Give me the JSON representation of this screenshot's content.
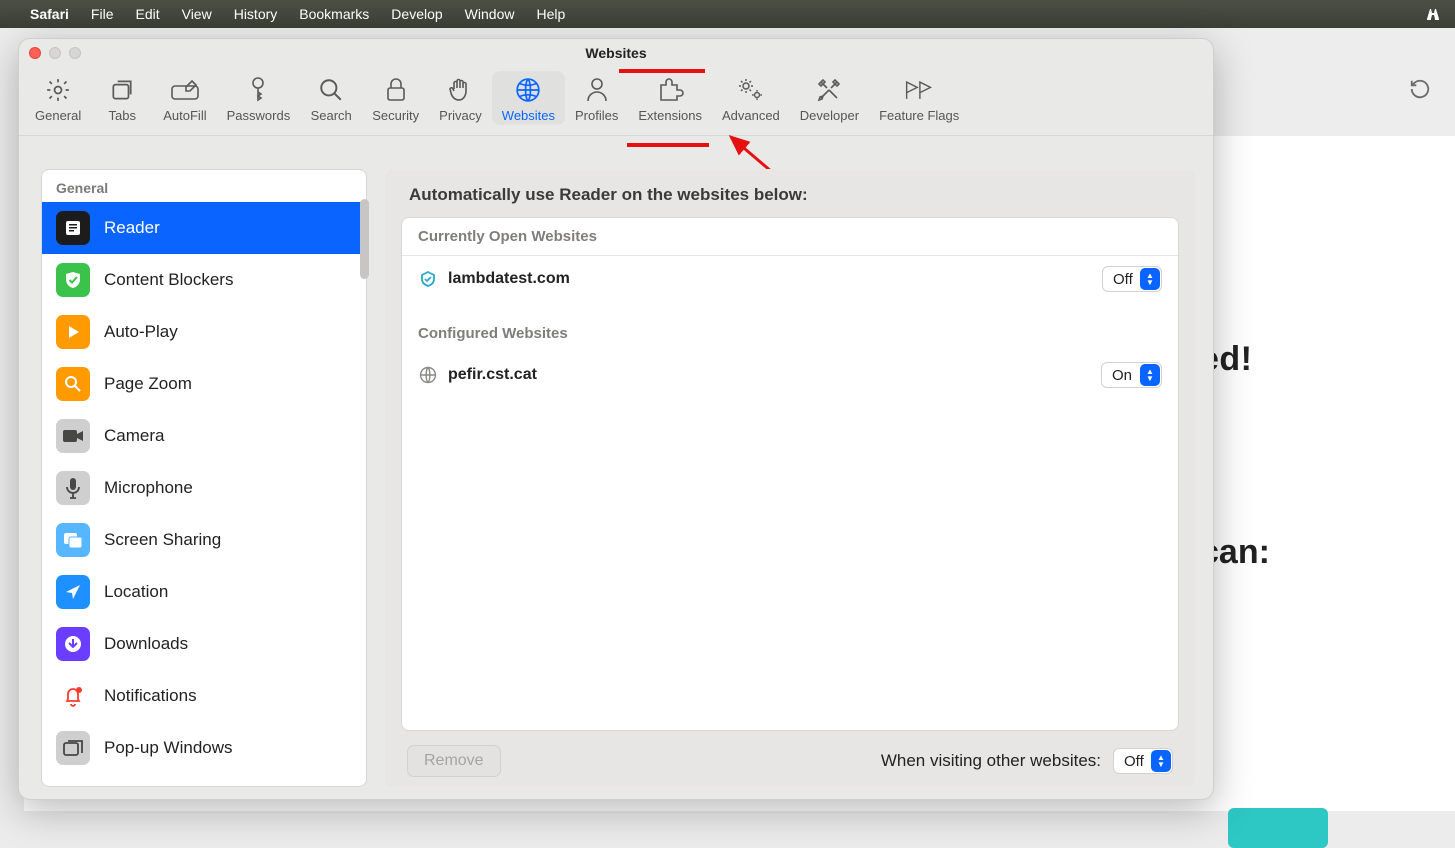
{
  "menubar": {
    "app": "Safari",
    "items": [
      "File",
      "Edit",
      "View",
      "History",
      "Bookmarks",
      "Develop",
      "Window",
      "Help"
    ]
  },
  "bg": {
    "text1": "ed!",
    "text2": "can:"
  },
  "prefs": {
    "title": "Websites",
    "tabs": [
      {
        "id": "general",
        "label": "General"
      },
      {
        "id": "tabs",
        "label": "Tabs"
      },
      {
        "id": "autofill",
        "label": "AutoFill"
      },
      {
        "id": "passwords",
        "label": "Passwords"
      },
      {
        "id": "search",
        "label": "Search"
      },
      {
        "id": "security",
        "label": "Security"
      },
      {
        "id": "privacy",
        "label": "Privacy"
      },
      {
        "id": "websites",
        "label": "Websites"
      },
      {
        "id": "profiles",
        "label": "Profiles"
      },
      {
        "id": "extensions",
        "label": "Extensions"
      },
      {
        "id": "advanced",
        "label": "Advanced"
      },
      {
        "id": "developer",
        "label": "Developer"
      },
      {
        "id": "featureflags",
        "label": "Feature Flags"
      }
    ],
    "sidebar": {
      "section": "General",
      "items": [
        {
          "label": "Reader"
        },
        {
          "label": "Content Blockers"
        },
        {
          "label": "Auto-Play"
        },
        {
          "label": "Page Zoom"
        },
        {
          "label": "Camera"
        },
        {
          "label": "Microphone"
        },
        {
          "label": "Screen Sharing"
        },
        {
          "label": "Location"
        },
        {
          "label": "Downloads"
        },
        {
          "label": "Notifications"
        },
        {
          "label": "Pop-up Windows"
        }
      ]
    },
    "main": {
      "heading": "Automatically use Reader on the websites below:",
      "open_header": "Currently Open Websites",
      "configured_header": "Configured Websites",
      "open_sites": [
        {
          "name": "lambdatest.com",
          "value": "Off"
        }
      ],
      "configured_sites": [
        {
          "name": "pefir.cst.cat",
          "value": "On"
        }
      ],
      "remove_label": "Remove",
      "default_label": "When visiting other websites:",
      "default_value": "Off"
    }
  }
}
